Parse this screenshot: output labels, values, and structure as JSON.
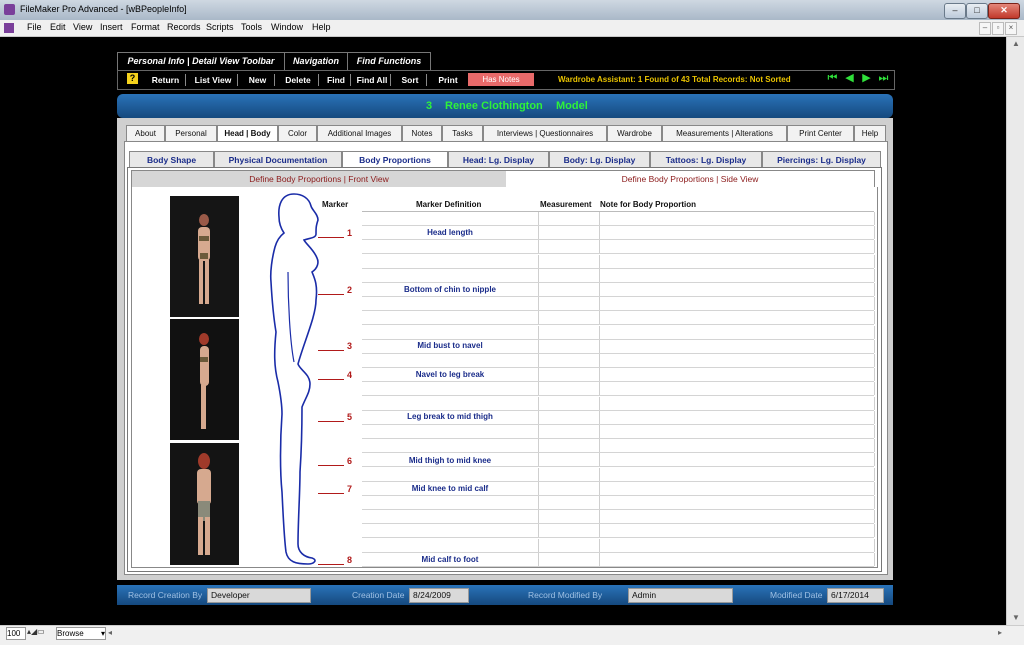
{
  "window": {
    "title": "FileMaker Pro Advanced - [wBPeopleInfo]",
    "minimize": "–",
    "maximize": "□",
    "close": "✕"
  },
  "menus": [
    "File",
    "Edit",
    "View",
    "Insert",
    "Format",
    "Records",
    "Scripts",
    "Tools",
    "Window",
    "Help"
  ],
  "toolbar_tabs": [
    "Personal Info | Detail View Toolbar",
    "Navigation",
    "Find Functions"
  ],
  "toolbar": {
    "help": "?",
    "buttons": [
      "Return",
      "List View",
      "New",
      "Delete",
      "Find",
      "Find All",
      "Sort",
      "Print"
    ],
    "has_notes": "Has Notes",
    "wardrobe_assistant": "Wardrobe Assistant:  1 Found of 43 Total Records: Not Sorted"
  },
  "record": {
    "number": "3",
    "name": "Renee Clothington",
    "role": "Model"
  },
  "main_tabs": [
    "About",
    "Personal",
    "Head | Body",
    "Color",
    "Additional Images",
    "Notes",
    "Tasks",
    "Interviews | Questionnaires",
    "Wardrobe",
    "Measurements | Alterations",
    "Print Center",
    "Help"
  ],
  "sub_tabs": [
    "Body Shape",
    "Physical Documentation",
    "Body Proportions",
    "Head: Lg. Display",
    "Body: Lg. Display",
    "Tattoos: Lg. Display",
    "Piercings: Lg. Display"
  ],
  "view_tabs": [
    "Define Body Proportions | Front View",
    "Define Body Proportions | Side View"
  ],
  "columns": {
    "marker": "Marker",
    "definition": "Marker Definition",
    "measurement": "Measurement",
    "note": "Note for Body Proportion"
  },
  "markers": [
    "1",
    "2",
    "3",
    "4",
    "5",
    "6",
    "7",
    "8"
  ],
  "definitions": [
    "Head length",
    "Bottom of chin to nipple",
    "Mid bust to navel",
    "Navel to leg break",
    "Leg break to mid thigh",
    "Mid thigh to mid knee",
    "Mid knee to mid calf",
    "Mid calf to foot"
  ],
  "footer": {
    "created_by_label": "Record Creation By",
    "created_by": "Developer",
    "creation_date_label": "Creation Date",
    "creation_date": "8/24/2009",
    "modified_by_label": "Record Modified By",
    "modified_by": "Admin",
    "modified_date_label": "Modified Date",
    "modified_date": "6/17/2014"
  },
  "statusbar": {
    "zoom": "100",
    "mode": "Browse"
  }
}
